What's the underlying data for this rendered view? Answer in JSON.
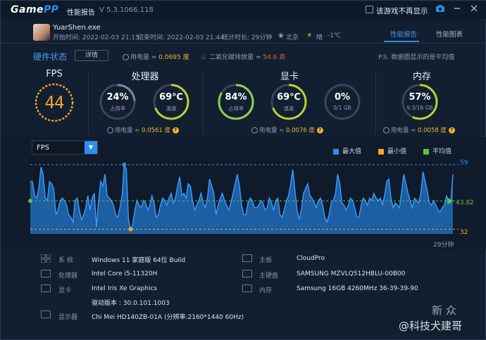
{
  "titlebar": {
    "logo_a": "Game",
    "logo_b": "PP",
    "title": "性能报告",
    "version": "V 5.3.1066.118",
    "dont_show": "该游戏不再显示"
  },
  "header": {
    "process": "YuarShen.exe",
    "start_time": "开始时间: 2022-02-03 21:15",
    "end_time": "结束时间: 2022-02-03 21:44",
    "duration": "统计时长: 29分钟",
    "location": "北京",
    "weather": "晴",
    "temp": "-1℃"
  },
  "tabs": [
    {
      "label": "性能报告",
      "active": true
    },
    {
      "label": "性能图表",
      "active": false
    }
  ],
  "status": {
    "hw_status": "硬件状态",
    "detail": "详情",
    "power_label": "用电量 ≈ ",
    "power_value": "0.0695 度",
    "co2_label": "二氧化碳排放量 ≈ ",
    "co2_value": "54.6 克",
    "note": "P.S. 数据圈显示的是平均值"
  },
  "sections": {
    "fps": "FPS",
    "cpu": "处理器",
    "gpu": "显卡",
    "mem": "内存"
  },
  "fps_value": "44",
  "gauges": [
    {
      "key": "cpu_usage",
      "value": "24%",
      "label": "占用率",
      "fraction": 0.24,
      "color": "#7d8a99"
    },
    {
      "key": "cpu_temp",
      "value": "69℃",
      "label": "温度",
      "fraction": 0.69,
      "color": "#b9cf3a"
    },
    {
      "key": "gpu_usage",
      "value": "84%",
      "label": "占用率",
      "fraction": 0.84,
      "color": "#8fd14f"
    },
    {
      "key": "gpu_temp",
      "value": "69℃",
      "label": "温度",
      "fraction": 0.69,
      "color": "#b9cf3a"
    },
    {
      "key": "gpu_mem",
      "value": "0%",
      "label": "0/1 GB",
      "fraction": 0.0,
      "color": "#7d8a99"
    },
    {
      "key": "mem_usage",
      "value": "57%",
      "label": "9.3/16 GB",
      "fraction": 0.57,
      "color": "#b9cf3a"
    }
  ],
  "power": {
    "label": "用电量 ≈ ",
    "cpu": "0.0561 度",
    "gpu": "0.0076 度",
    "mem": "0.0058 度"
  },
  "chart_controls": {
    "select": "FPS",
    "legend": [
      {
        "label": "最大值",
        "color": "#2f8ef0"
      },
      {
        "label": "最小值",
        "color": "#f2a62a"
      },
      {
        "label": "平均值",
        "color": "#5cc24a"
      }
    ]
  },
  "chart_data": {
    "type": "area",
    "title": "",
    "xlabel": "29分钟",
    "ylabel": "FPS",
    "max": 59,
    "min": 32,
    "avg": 43.82,
    "ylim": [
      30,
      60
    ],
    "grid": true,
    "values": [
      52,
      52,
      46,
      45,
      49,
      58,
      55,
      45,
      44,
      52,
      51,
      49,
      38,
      40,
      44,
      45,
      44,
      42,
      38,
      37,
      35,
      44,
      45,
      40,
      36,
      38,
      41,
      46,
      40,
      45,
      47,
      33,
      44,
      52,
      50,
      55,
      46,
      45,
      44,
      42,
      38,
      37,
      41,
      46,
      59,
      57,
      36,
      32,
      34,
      40,
      44,
      42,
      41,
      44,
      43,
      40,
      42,
      46,
      43,
      37,
      38,
      42,
      45,
      44,
      42,
      45,
      47,
      43,
      45,
      50,
      54,
      46,
      47,
      45,
      51,
      50,
      44,
      40,
      42,
      44,
      47,
      43,
      41,
      45,
      53,
      50,
      47,
      38,
      42,
      45,
      47,
      44,
      42,
      40,
      43,
      47,
      51,
      55,
      50,
      42,
      38,
      38,
      43,
      45,
      44,
      41,
      41,
      42,
      44,
      43,
      40,
      41,
      45,
      43,
      40,
      44,
      45,
      38,
      37,
      40,
      44,
      46,
      51,
      57,
      48,
      40,
      36,
      40,
      47,
      49,
      51,
      46,
      45,
      43,
      41,
      44,
      45,
      42,
      37,
      35,
      38,
      43,
      44,
      47,
      55,
      51,
      43,
      42,
      40,
      42,
      45,
      44,
      41,
      37,
      37,
      42,
      45,
      44,
      42,
      45,
      44,
      47,
      45,
      44,
      45,
      42,
      46,
      52,
      53,
      45,
      41,
      43,
      42,
      41,
      48,
      55,
      51,
      47,
      44,
      41,
      45,
      44,
      43,
      47,
      56,
      52,
      48,
      43,
      42,
      44,
      42,
      40,
      39,
      41,
      42,
      46,
      44,
      43,
      55
    ]
  },
  "system": {
    "os_label": "系    统",
    "os": "Windows 11 家庭版 64位   Build",
    "cpu_label": "处理器",
    "cpu": "Intel Core i5-11320H",
    "gpu_label": "显卡",
    "gpu": "Intel Iris Xe Graphics",
    "driver": "驱动版本 : 30.0.101.1003",
    "display_label": "显示器",
    "display": "Chi Mei HD140ZB-01A (分辨率:2160*1440 60Hz)",
    "board_label": "主板",
    "board": "CloudPro",
    "disk_label": "主硬盘",
    "disk": "SAMSUNG MZVLQ512HBLU-00B00",
    "ram_label": "内存",
    "ram": "Samsung 16GB 4260MHz 36-39-39-90"
  },
  "watermark": {
    "site": "新 众",
    "user": "@科技犬建哥"
  }
}
